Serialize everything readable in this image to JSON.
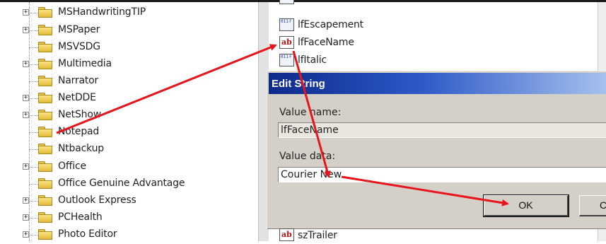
{
  "tree": {
    "items": [
      {
        "label": "MSHandwritingTIP",
        "expandable": true
      },
      {
        "label": "MSPaper",
        "expandable": true
      },
      {
        "label": "MSVSDG",
        "expandable": false
      },
      {
        "label": "Multimedia",
        "expandable": true
      },
      {
        "label": "Narrator",
        "expandable": false
      },
      {
        "label": "NetDDE",
        "expandable": true
      },
      {
        "label": "NetShow",
        "expandable": true
      },
      {
        "label": "Notepad",
        "expandable": false
      },
      {
        "label": "Ntbackup",
        "expandable": false
      },
      {
        "label": "Office",
        "expandable": true
      },
      {
        "label": "Office Genuine Advantage",
        "expandable": false
      },
      {
        "label": "Outlook Express",
        "expandable": true
      },
      {
        "label": "PCHealth",
        "expandable": true
      },
      {
        "label": "Photo Editor",
        "expandable": true
      }
    ]
  },
  "values": {
    "items": [
      {
        "label": "lfEscapement",
        "icon": "binary-value-icon"
      },
      {
        "label": "lfFaceName",
        "icon": "string-value-icon"
      },
      {
        "label": "lfItalic",
        "icon": "binary-value-icon"
      }
    ],
    "bottom_label": "szTrailer"
  },
  "dialog": {
    "title": "Edit String",
    "value_name_label": "Value name:",
    "value_name": "lfFaceName",
    "value_data_label": "Value data:",
    "value_data": "Courier New",
    "ok_label": "OK",
    "cancel_label": "C"
  },
  "colors": {
    "annotation_arrow": "#e8141b",
    "titlebar": "#0c2a8a",
    "folder": "#f5d15c"
  }
}
